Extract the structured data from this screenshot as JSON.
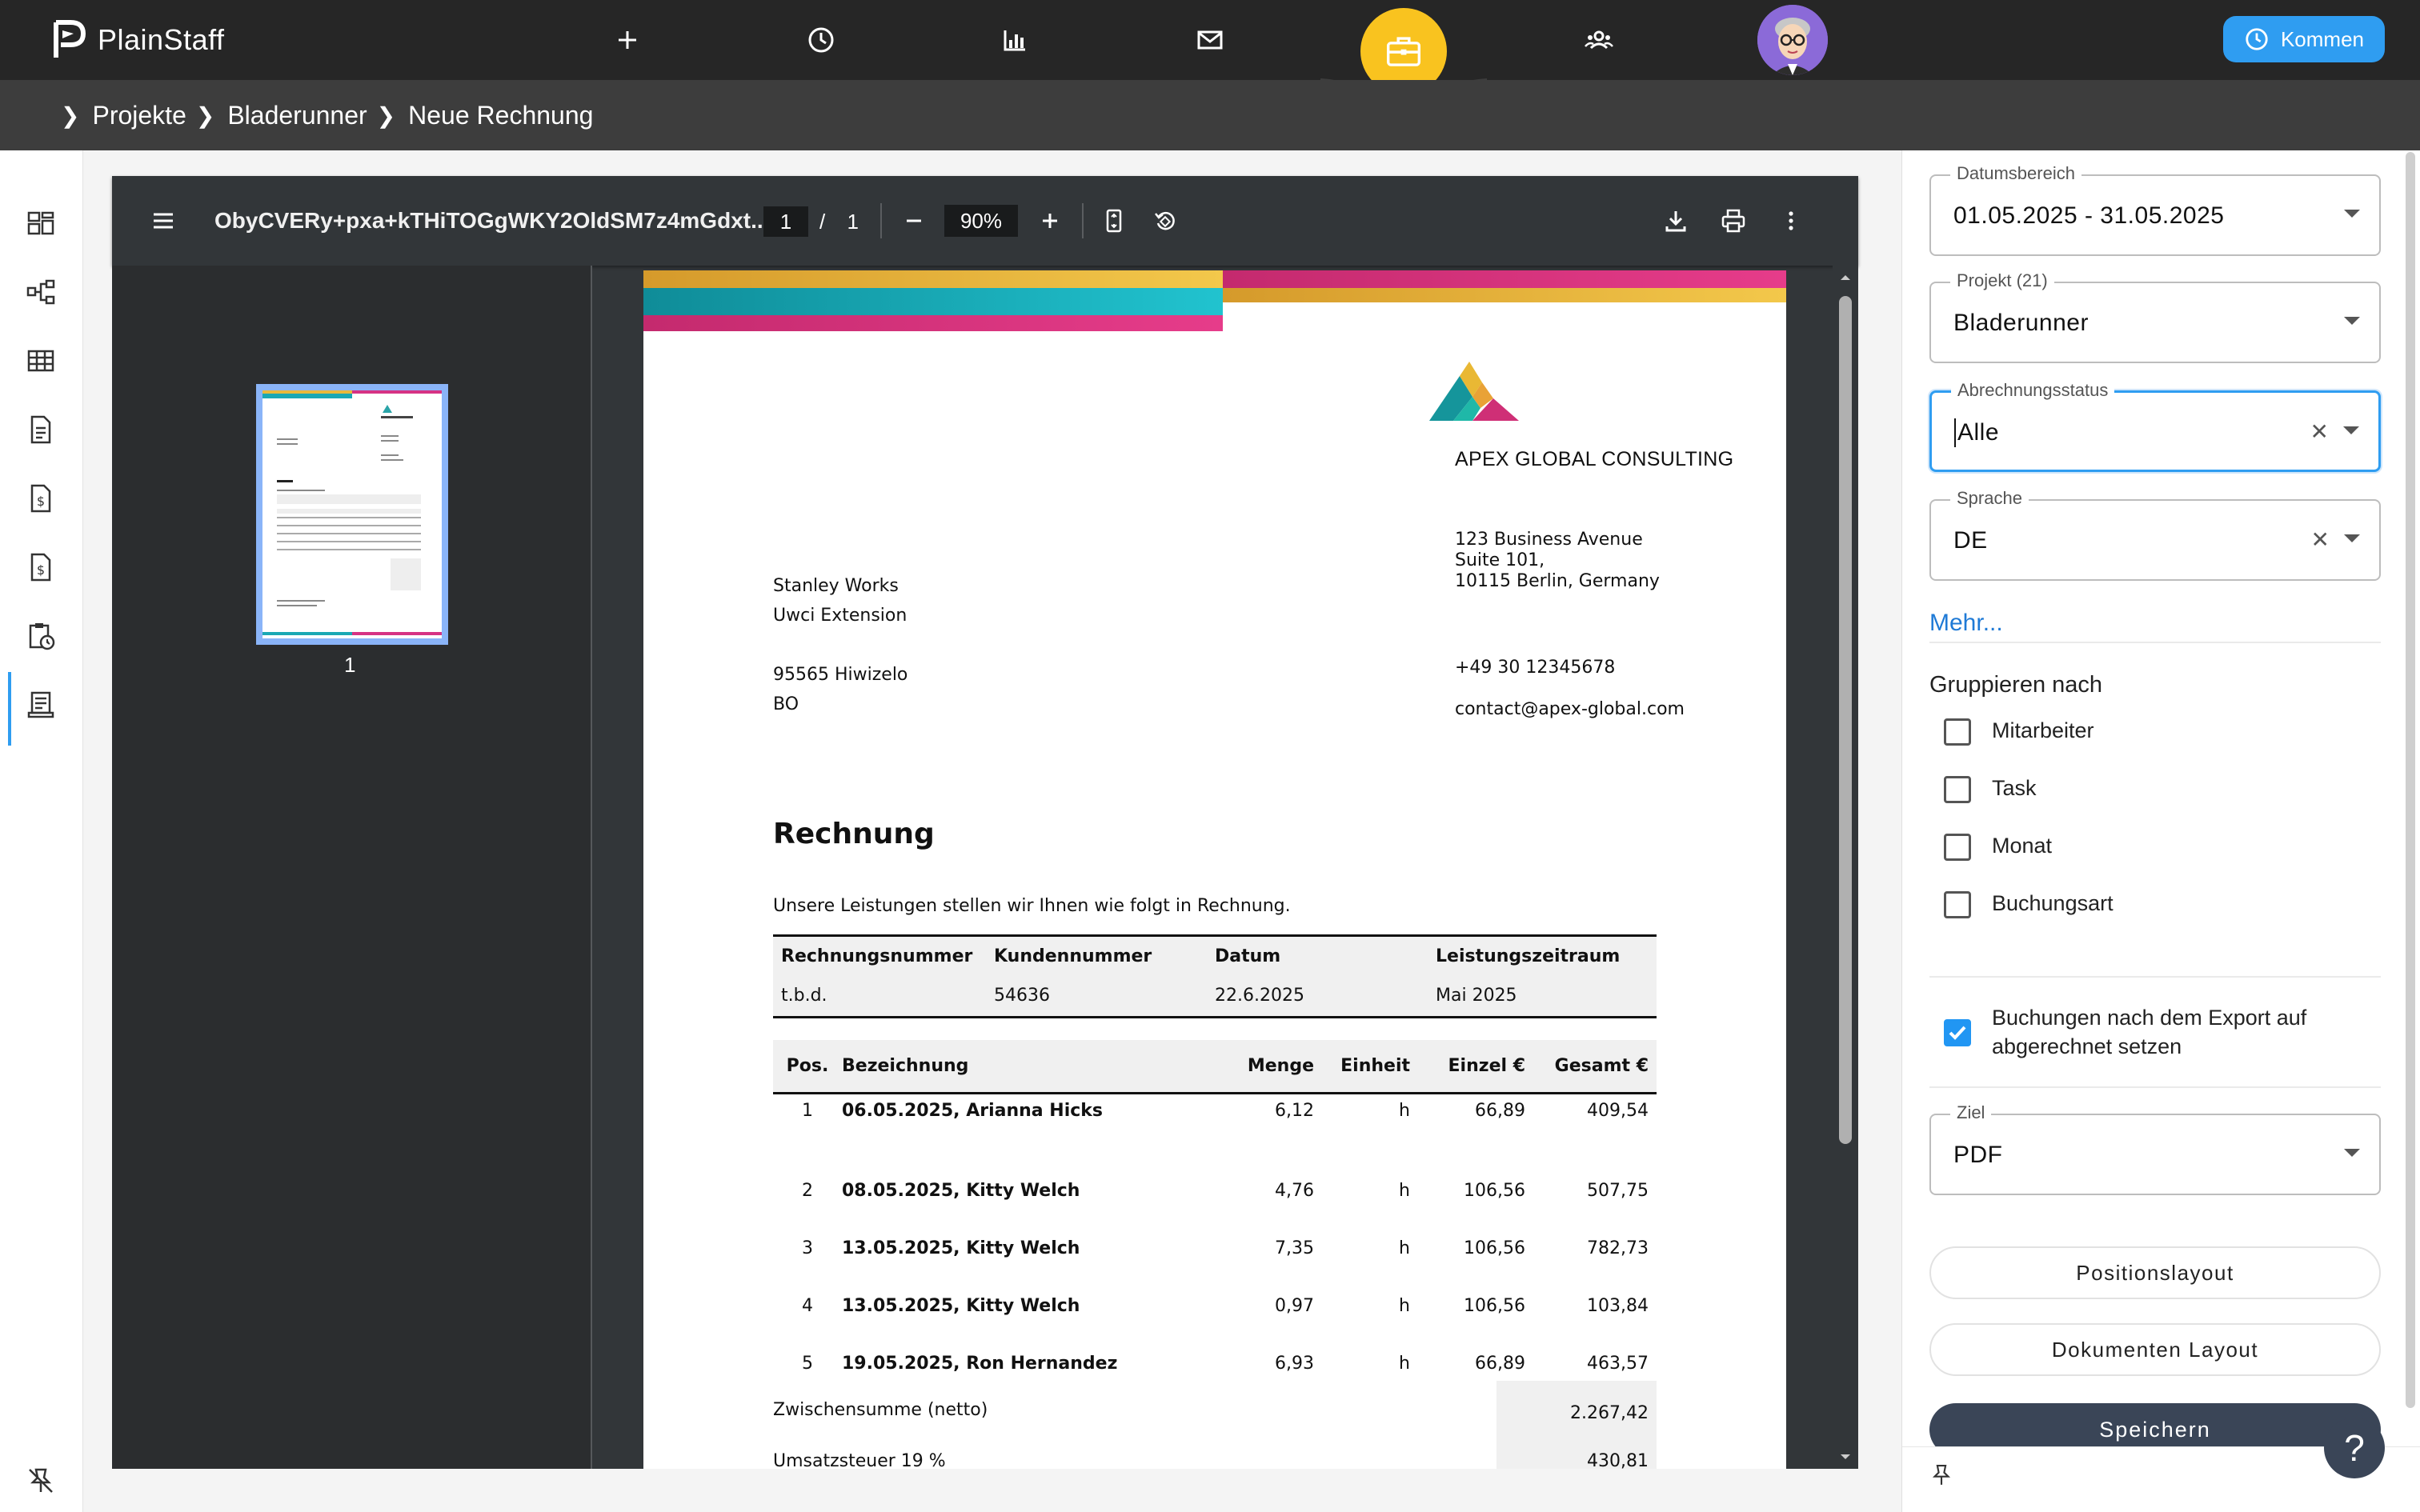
{
  "app": {
    "name": "PlainStaff",
    "kommen_label": "Kommen"
  },
  "breadcrumb": [
    "Projekte",
    "Bladerunner",
    "Neue Rechnung"
  ],
  "viewer": {
    "file_title": "ObyCVERy+pxa+kTHiTOGgWKY2OldSM7z4mGdxt...",
    "current_page": "1",
    "page_sep": "/",
    "total_pages": "1",
    "zoom": "90%",
    "thumb_label": "1"
  },
  "invoice": {
    "company_name": "APEX GLOBAL CONSULTING",
    "company_address": [
      "123 Business Avenue",
      "Suite 101,",
      "10115 Berlin, Germany"
    ],
    "company_phone": "+49 30 12345678",
    "company_email": "contact@apex-global.com",
    "recipient": [
      "Stanley Works",
      "Uwci Extension",
      "",
      "95565 Hiwizelo",
      "BO"
    ],
    "heading": "Rechnung",
    "intro": "Unsere Leistungen stellen wir Ihnen wie folgt in Rechnung.",
    "meta_headers": [
      "Rechnungsnummer",
      "Kundennummer",
      "Datum",
      "Leistungszeitraum"
    ],
    "meta_values": [
      "t.b.d.",
      "54636",
      "22.6.2025",
      "Mai 2025"
    ],
    "item_headers": [
      "Pos.",
      "Bezeichnung",
      "Menge",
      "Einheit",
      "Einzel €",
      "Gesamt €"
    ],
    "items": [
      [
        "1",
        "06.05.2025, Arianna Hicks",
        "6,12",
        "h",
        "66,89",
        "409,54"
      ],
      [
        "2",
        "08.05.2025, Kitty Welch",
        "4,76",
        "h",
        "106,56",
        "507,75"
      ],
      [
        "3",
        "13.05.2025, Kitty Welch",
        "7,35",
        "h",
        "106,56",
        "782,73"
      ],
      [
        "4",
        "13.05.2025, Kitty Welch",
        "0,97",
        "h",
        "106,56",
        "103,84"
      ],
      [
        "5",
        "19.05.2025, Ron Hernandez",
        "6,93",
        "h",
        "66,89",
        "463,57"
      ]
    ],
    "subtotal_label": "Zwischensumme (netto)",
    "subtotal_value": "2.267,42",
    "vat_label": "Umsatzsteuer 19 %",
    "vat_value": "430,81"
  },
  "filters": {
    "date_range": {
      "label": "Datumsbereich",
      "value": "01.05.2025 - 31.05.2025"
    },
    "project": {
      "label": "Projekt (21)",
      "value": "Bladerunner"
    },
    "billing_status": {
      "label": "Abrechnungsstatus",
      "value": "Alle"
    },
    "language": {
      "label": "Sprache",
      "value": "DE"
    },
    "more_link": "Mehr...",
    "group_by_title": "Gruppieren nach",
    "group_by": [
      "Mitarbeiter",
      "Task",
      "Monat",
      "Buchungsart"
    ],
    "export_option": "Buchungen nach dem Export auf abgerechnet setzen",
    "target": {
      "label": "Ziel",
      "value": "PDF"
    },
    "position_layout_label": "Positionslayout",
    "document_layout_label": "Dokumenten Layout",
    "save_label": "Speichern"
  },
  "help_label": "?",
  "colors": {
    "accent": "#2f9df1",
    "brand_yellow": "#f9c31f",
    "topbar": "#262626",
    "save_button": "#3a4557"
  }
}
